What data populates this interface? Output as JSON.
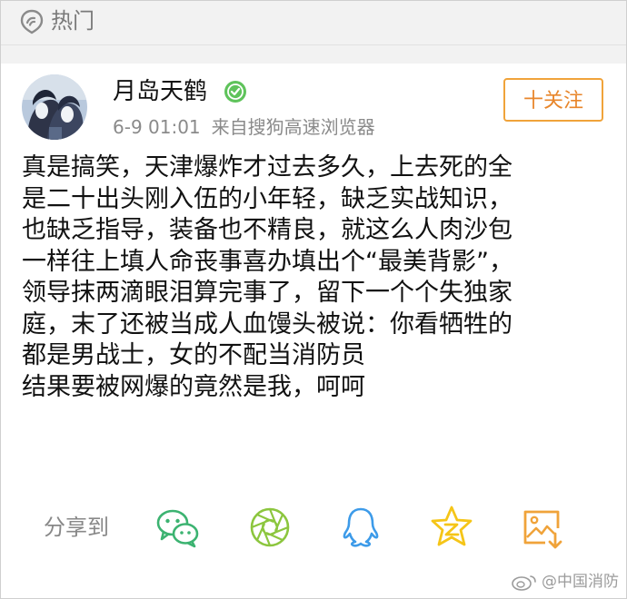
{
  "header": {
    "title": "热门",
    "icon": "hot-pin-icon"
  },
  "post": {
    "author": "月岛天鹤",
    "verified_icon": "verified-badge-icon",
    "time": "6-9 01:01",
    "source": "来自搜狗高速浏览器",
    "follow_label": "十关注",
    "lines": [
      "真是搞笑，天津爆炸才过去多久，上去死的全",
      "是二十出头刚入伍的小年轻，缺乏实战知识，",
      "也缺乏指导，装备也不精良，就这么人肉沙包",
      "一样往上填人命丧事喜办填出个“最美背影”，",
      "领导抹两滴眼泪算完事了，留下一个个失独家",
      "庭，末了还被当成人血馒头被说：你看牺牲的",
      "都是男战士，女的不配当消防员",
      "结果要被网爆的竟然是我，呵呵"
    ]
  },
  "share": {
    "label": "分享到",
    "targets": [
      {
        "name": "wechat",
        "icon": "wechat-icon",
        "color": "#3cb371"
      },
      {
        "name": "moments",
        "icon": "moments-icon",
        "color": "#8cc63e"
      },
      {
        "name": "qq",
        "icon": "qq-icon",
        "color": "#3d9be9"
      },
      {
        "name": "qzone",
        "icon": "qzone-star-icon",
        "color": "#f5c518"
      },
      {
        "name": "save-image",
        "icon": "save-image-icon",
        "color": "#f0a33a"
      }
    ]
  },
  "watermark": {
    "text": "@中国消防"
  }
}
